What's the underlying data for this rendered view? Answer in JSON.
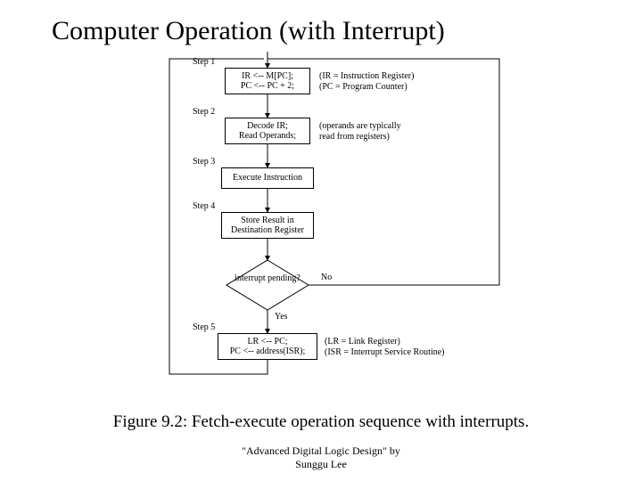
{
  "title": "Computer Operation (with Interrupt)",
  "steps": {
    "s1": "Step 1",
    "s2": "Step 2",
    "s3": "Step 3",
    "s4": "Step 4",
    "s5": "Step 5"
  },
  "boxes": {
    "b1a": "IR <-- M[PC];",
    "b1b": "PC <-- PC + 2;",
    "b2a": "Decode IR;",
    "b2b": "Read Operands;",
    "b3": "Execute Instruction",
    "b4a": "Store Result in",
    "b4b": "Destination Register",
    "dec": "interrupt pending?",
    "b5a": "LR <-- PC;",
    "b5b": "PC <-- address(ISR);"
  },
  "notes": {
    "n1a": "(IR = Instruction Register)",
    "n1b": "(PC = Program Counter)",
    "n2a": "(operands are typically",
    "n2b": "read from registers)",
    "n5a": "(LR = Link Register)",
    "n5b": "(ISR = Interrupt Service Routine)"
  },
  "branches": {
    "no": "No",
    "yes": "Yes"
  },
  "caption": "Figure 9.2: Fetch-execute operation sequence with interrupts.",
  "credit1": "\"Advanced Digital Logic Design\" by",
  "credit2": "Sunggu Lee"
}
